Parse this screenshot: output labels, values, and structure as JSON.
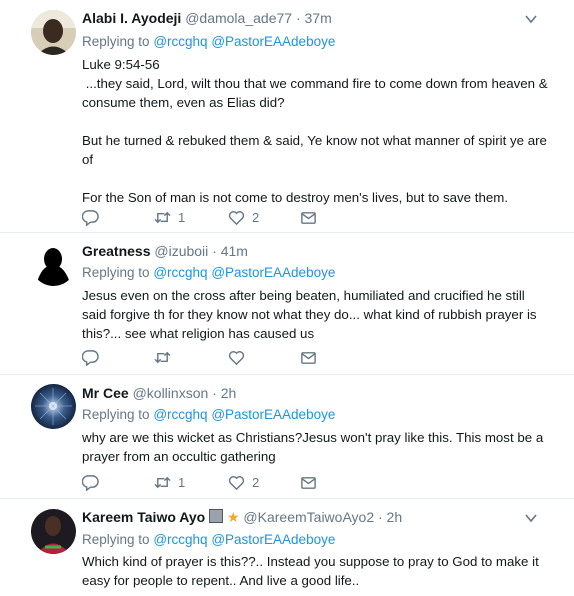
{
  "tweets": [
    {
      "name": "Alabi I. Ayodeji",
      "handle": "@damola_ade77",
      "time": "· 37m",
      "replying_label": "Replying to",
      "mention1": "@rccghq",
      "mention2": "@PastorEAAdeboye",
      "text": "Luke 9:54-56\n ...they said, Lord, wilt thou that we command fire to come down from heaven & consume them, even as Elias did?\n\nBut he turned & rebuked them & said, Ye know not what manner of spirit ye are of\n\nFor the Son of man is not come to destroy men's lives, but to save them.",
      "retweets": "1",
      "likes": "2"
    },
    {
      "name": "Greatness",
      "handle": "@izuboii",
      "time": "· 41m",
      "replying_label": "Replying to",
      "mention1": "@rccghq",
      "mention2": "@PastorEAAdeboye",
      "text": "Jesus even on the cross after being beaten, humiliated and crucified he still said forgive th for they know not what they do... what kind of rubbish prayer is this?... see what religion has caused us",
      "retweets": "",
      "likes": ""
    },
    {
      "name": "Mr Cee",
      "handle": "@kollinxson",
      "time": "· 2h",
      "replying_label": "Replying to",
      "mention1": "@rccghq",
      "mention2": "@PastorEAAdeboye",
      "text": "why are we this wicket as Christians?Jesus won't pray like this. This most be a prayer from an occultic gathering",
      "retweets": "1",
      "likes": "2"
    },
    {
      "name": "Kareem Taiwo Ayo",
      "handle": "@KareemTaiwoAyo2",
      "time": "· 2h",
      "replying_label": "Replying to",
      "mention1": "@rccghq",
      "mention2": "@PastorEAAdeboye",
      "text": "Which kind of prayer is this??.. Instead you suppose to pray to God to make it easy for people to repent.. And live a good life..",
      "retweets": "",
      "likes": ""
    }
  ],
  "colors": {
    "link": "#1b95e0",
    "muted": "#657786",
    "text": "#14171a",
    "divider": "#e6ecf0"
  },
  "icons": [
    "reply-icon",
    "retweet-icon",
    "like-icon",
    "dm-icon",
    "caret-down-icon",
    "calendar-emoji-icon",
    "star-emoji-icon"
  ]
}
